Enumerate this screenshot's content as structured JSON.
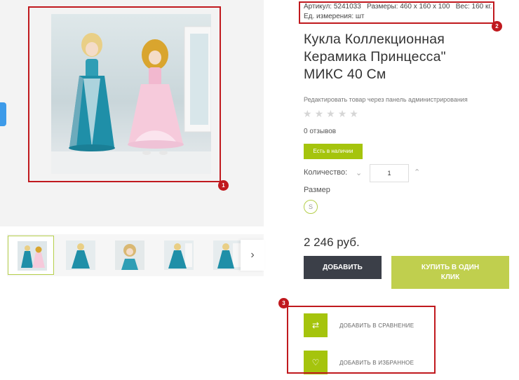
{
  "gallery": {
    "thumb_count": 5,
    "next_icon": "chevron-right-icon"
  },
  "product": {
    "article": "Артикул: 5241033",
    "dimensions": "Размеры: 460 x 160 x 100",
    "weight": "Вес: 160 кг.",
    "unit": "Ед. измерения: шт",
    "title_lines": [
      "Кукла Коллекционная",
      "Керамика Принцесса\"",
      "МИКС 40 См"
    ],
    "admin_link": "Редактировать товар через панель администрирования",
    "rating": {
      "value": 0,
      "max": 5
    },
    "reviews": "0 отзывов",
    "availability": "Есть в наличии",
    "quantity_label": "Количество:",
    "quantity_value": "1",
    "size_label": "Размер",
    "size_option": "S",
    "price": "2 246 руб."
  },
  "buttons": {
    "add": "ДОБАВИТЬ",
    "one_click_lines": [
      "КУПИТЬ В ОДИН",
      "КЛИК"
    ]
  },
  "actions": [
    {
      "icon": "shuffle-icon",
      "label": "ДОБАВИТЬ В СРАВНЕНИЕ"
    },
    {
      "icon": "heart-icon",
      "label": "ДОБАВИТЬ В ИЗБРАННОЕ"
    }
  ],
  "annotations": [
    "1",
    "2",
    "3"
  ],
  "colors": {
    "accent_green": "#a5c40d",
    "dark_button": "#3b3f48",
    "annotation_red": "#c0191e",
    "side_tab_blue": "#3d9be9"
  }
}
